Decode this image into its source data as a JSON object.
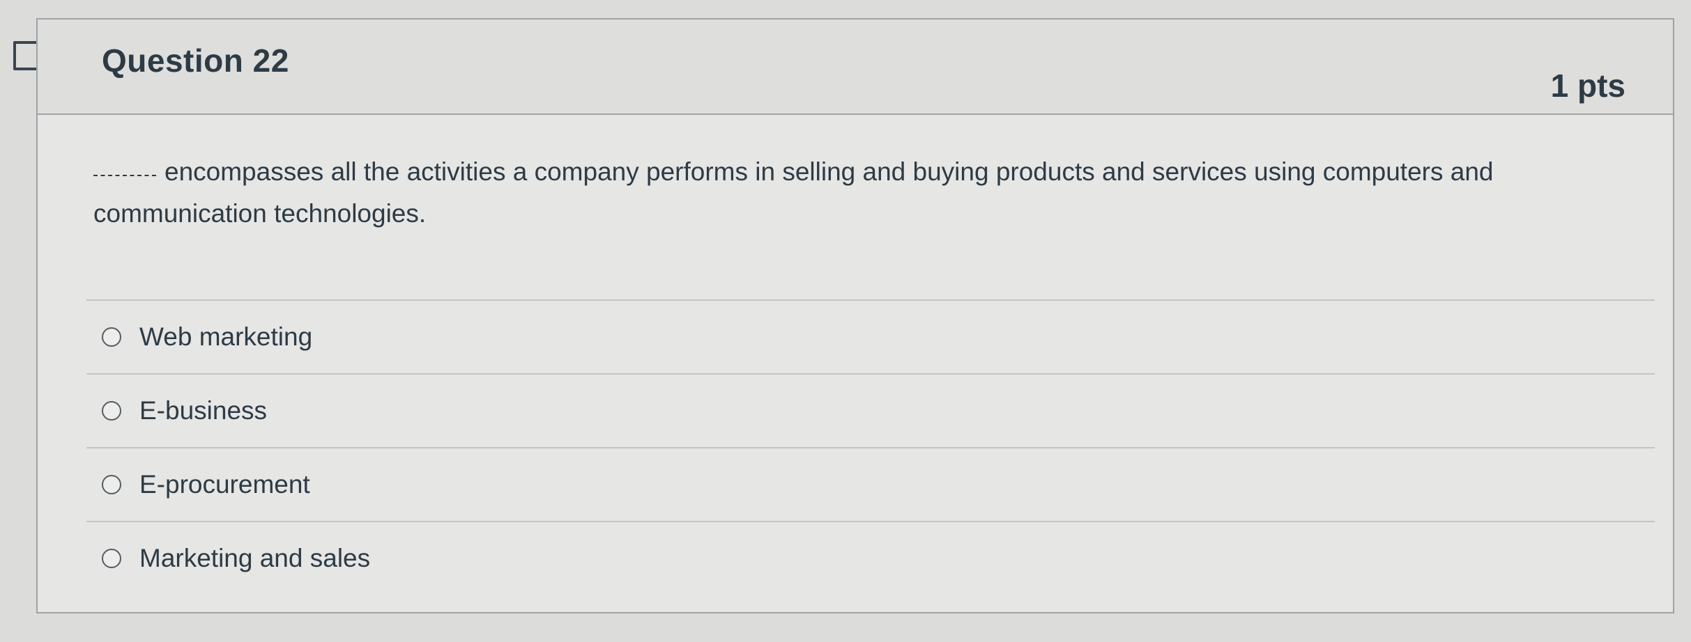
{
  "question": {
    "title": "Question 22",
    "points": "1 pts",
    "blank": "_____",
    "text": "encompasses all the activities a company performs in selling and buying products and services using computers and communication technologies."
  },
  "answers": [
    {
      "label": "Web marketing",
      "selected": false
    },
    {
      "label": "E-business",
      "selected": false
    },
    {
      "label": "E-procurement",
      "selected": false
    },
    {
      "label": "Marketing and sales",
      "selected": false
    }
  ],
  "icons": {
    "flag": "flag-bookmark-icon",
    "radio": "radio-unselected-icon"
  }
}
